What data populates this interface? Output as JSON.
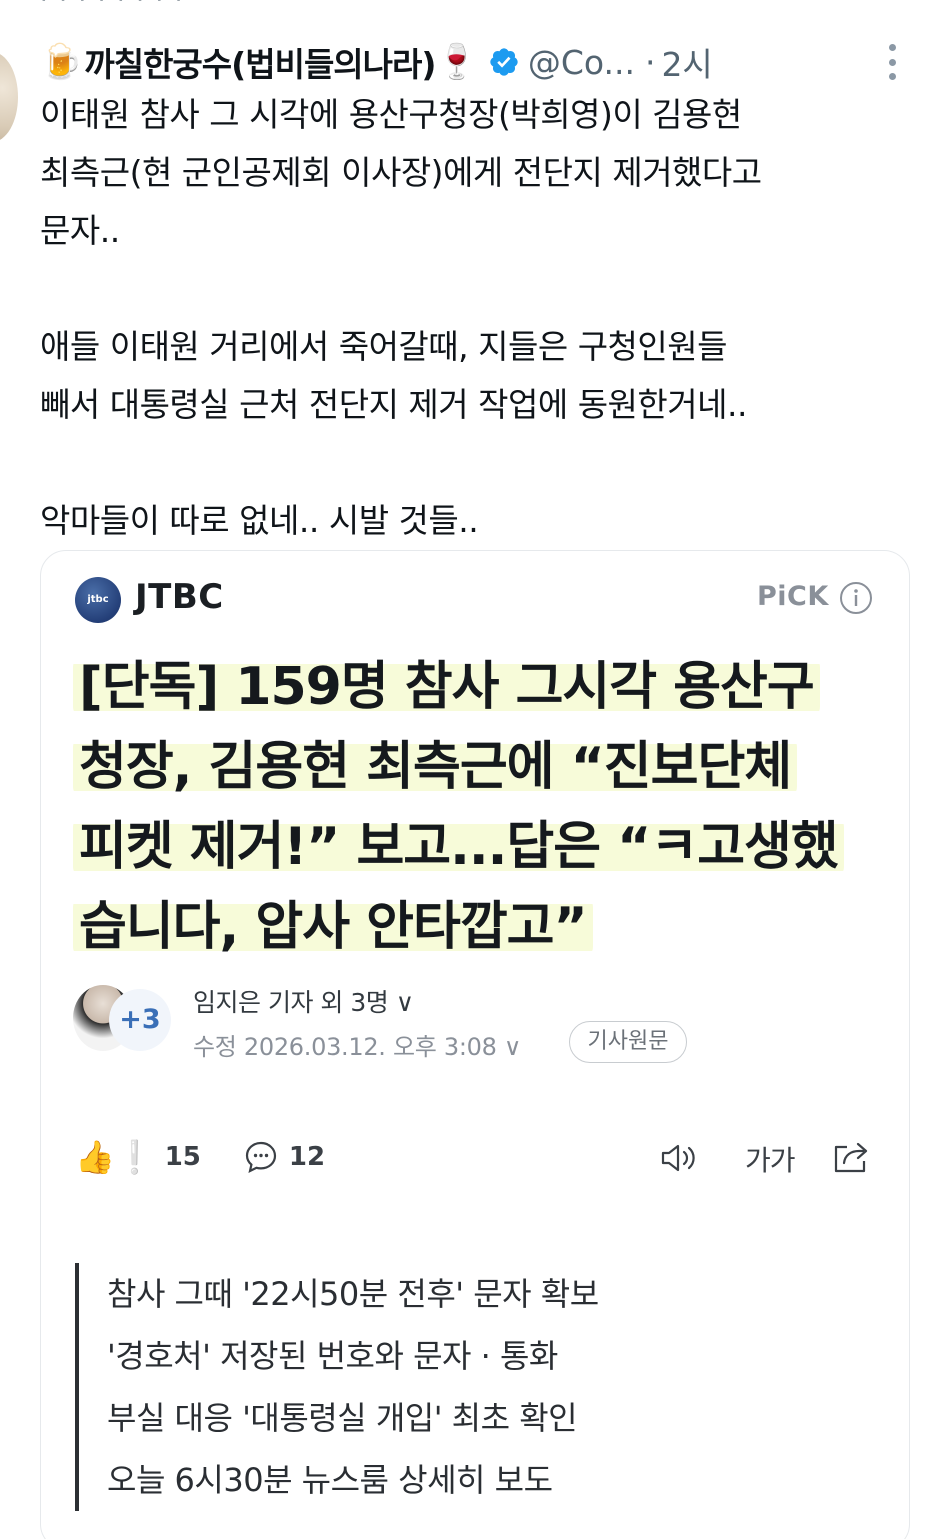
{
  "post": {
    "display_name": "까칠한궁수(법비들의나라)",
    "name_prefix_emoji": "🍺",
    "name_suffix_emoji": "🍷",
    "handle": "@Co...",
    "separator": "·",
    "time": "2시",
    "body": "이태원 참사 그 시각에 용산구청장(박희영)이 김용현\n최측근(현 군인공제회 이사장)에게 전단지 제거했다고\n문자..\n\n애들 이태원 거리에서 죽어갈때, 지들은 구청인원들\n빼서 대통령실 근처 전단지 제거 작업에 동원한거네..\n\n악마들이 따로 없네.. 시발 것들.."
  },
  "card": {
    "source_logo_text": "jtbc",
    "source_name": "JTBC",
    "pick_label": "PiCK",
    "headline_lines": [
      "[단독] 159명 참사 그시각 용산구",
      "청장, 김용현 최측근에 “진보단체",
      "피켓 제거!” 보고...답은 “ㅋ고생했",
      "습니다, 압사 안타깝고”"
    ],
    "reporter_badge": "+3",
    "reporter": "임지은 기자 외 3명 ∨",
    "edited": "수정 2026.03.12. 오후 3:08 ∨",
    "original_button": "기사원문",
    "reaction_emoji": "👍❕",
    "reaction_count": "15",
    "comment_count": "12",
    "font_size_label": "가가",
    "summary": [
      "참사 그때 '22시50분 전후' 문자 확보",
      "'경호처' 저장된 번호와 문자 · 통화",
      "부실 대응 '대통령실 개입' 최초 확인",
      "오늘 6시30분 뉴스룸 상세히 보도"
    ]
  },
  "colors": {
    "verified": "#1d9bf0",
    "highlight": "#f7fbd9",
    "secondary_text": "#536471"
  }
}
